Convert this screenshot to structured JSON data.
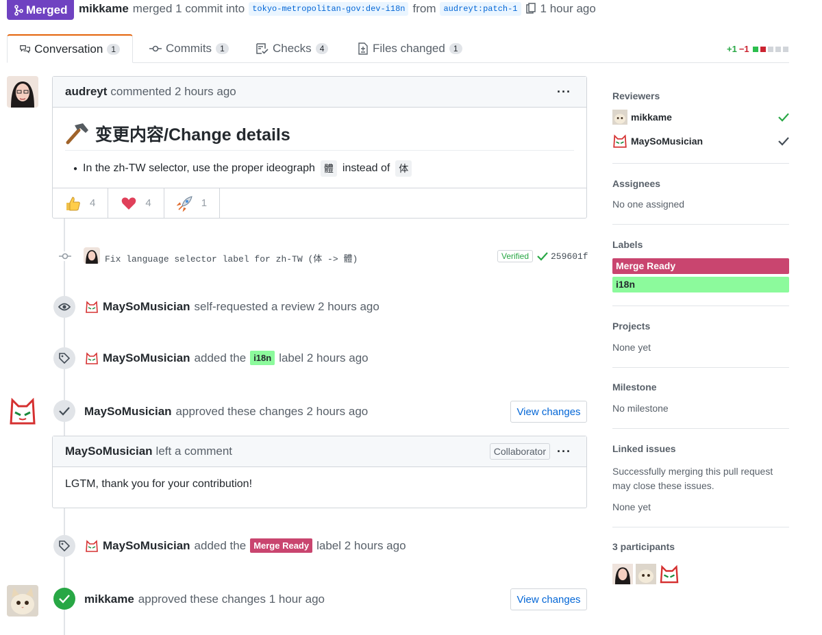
{
  "header": {
    "state": "Merged",
    "author": "mikkame",
    "action": "merged 1 commit into",
    "base_branch": "tokyo-metropolitan-gov:dev-i18n",
    "from_word": "from",
    "head_branch": "audreyt:patch-1",
    "time": "1 hour ago"
  },
  "tabs": [
    {
      "label": "Conversation",
      "count": "1",
      "icon": "conversation-icon"
    },
    {
      "label": "Commits",
      "count": "1",
      "icon": "commit-icon"
    },
    {
      "label": "Checks",
      "count": "4",
      "icon": "checklist-icon"
    },
    {
      "label": "Files changed",
      "count": "1",
      "icon": "file-diff-icon"
    }
  ],
  "diffstat": {
    "additions": "+1",
    "deletions": "−1"
  },
  "first_comment": {
    "author": "audreyt",
    "meta": "commented 2 hours ago",
    "heading": "变更内容/Change details",
    "bullet_before": "In the zh-TW selector, use the proper ideograph",
    "code_a": "體",
    "bullet_mid": "instead of",
    "code_b": "体",
    "reactions": [
      {
        "icon": "thumbs-up-icon",
        "count": "4"
      },
      {
        "icon": "heart-icon",
        "count": "4"
      },
      {
        "icon": "rocket-icon",
        "count": "1"
      }
    ]
  },
  "commit": {
    "message": "Fix language selector label for zh-TW (体 -> 體)",
    "verified": "Verified",
    "sha": "259601f"
  },
  "events": {
    "review_request": {
      "who": "MaySoMusician",
      "text": "self-requested a review 2 hours ago"
    },
    "label_i18n": {
      "who": "MaySoMusician",
      "before": "added the",
      "label": "i18n",
      "after": "label 2 hours ago"
    },
    "approve1": {
      "who": "MaySoMusician",
      "text": "approved these changes 2 hours ago",
      "button": "View changes"
    },
    "review_comment": {
      "who": "MaySoMusician",
      "meta": "left a comment",
      "role": "Collaborator",
      "body": "LGTM, thank you for your contribution!"
    },
    "label_merge": {
      "who": "MaySoMusician",
      "before": "added the",
      "label": "Merge Ready",
      "after": "label 2 hours ago"
    },
    "approve2": {
      "who": "mikkame",
      "text": "approved these changes 1 hour ago",
      "button": "View changes"
    }
  },
  "sidebar": {
    "reviewers_title": "Reviewers",
    "reviewers": [
      {
        "name": "mikkame"
      },
      {
        "name": "MaySoMusician"
      }
    ],
    "assignees_title": "Assignees",
    "assignees_value": "No one assigned",
    "labels_title": "Labels",
    "labels": [
      {
        "name": "Merge Ready",
        "color": "#c9456f",
        "text_color": "#ffffff"
      },
      {
        "name": "i18n",
        "color": "#8cfa9c",
        "text_color": "#24292e"
      }
    ],
    "projects_title": "Projects",
    "projects_value": "None yet",
    "milestone_title": "Milestone",
    "milestone_value": "No milestone",
    "linked_title": "Linked issues",
    "linked_desc": "Successfully merging this pull request may close these issues.",
    "linked_value": "None yet",
    "participants_title": "3 participants"
  },
  "colors": {
    "merged": "#6f42c1",
    "success": "#28a745",
    "link": "#0366d6"
  }
}
